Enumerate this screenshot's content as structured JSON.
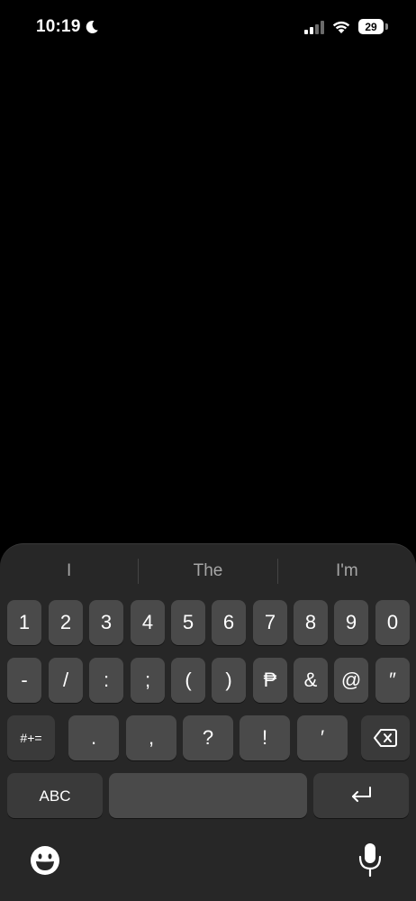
{
  "status_bar": {
    "time": "10:19",
    "focus_icon": "moon-icon",
    "battery_level": "29"
  },
  "keyboard": {
    "suggestions": [
      "I",
      "The",
      "I'm"
    ],
    "number_row": [
      "1",
      "2",
      "3",
      "4",
      "5",
      "6",
      "7",
      "8",
      "9",
      "0"
    ],
    "symbol_row": [
      "-",
      "/",
      ":",
      ";",
      "(",
      ")",
      "₱",
      "&",
      "@",
      "″"
    ],
    "punct_row": {
      "more_symbols": "#+=",
      "keys": [
        ".",
        ",",
        "?",
        "!",
        "′"
      ]
    },
    "bottom_row": {
      "abc": "ABC",
      "space": "",
      "return_icon": "return-icon"
    },
    "emoji_icon": "emoji-icon",
    "mic_icon": "microphone-icon"
  },
  "colors": {
    "background": "#000000",
    "keyboard_bg": "#272727",
    "key_bg": "#4a4a4a",
    "special_key_bg": "#3a3a3a",
    "suggestion_text": "#a6a6a6"
  }
}
